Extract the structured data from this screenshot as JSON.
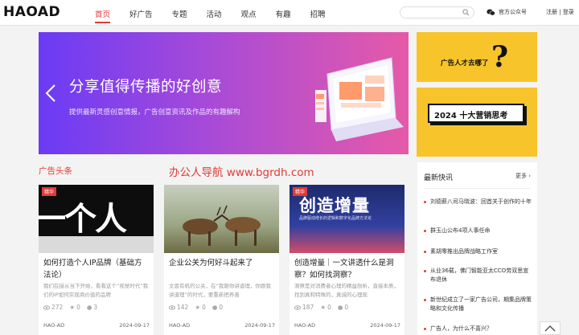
{
  "header": {
    "logo": "HAOAD",
    "nav": [
      "首页",
      "好广告",
      "专题",
      "活动",
      "观点",
      "有趣",
      "招聘"
    ],
    "search_placeholder": "",
    "wechat_label": "官方公众号",
    "login": "注册",
    "register": "登录"
  },
  "banner": {
    "title": "分享值得传播的好创意",
    "subtitle": "提供最新灵感创意情报，广告创意资讯及作品的有趣解构"
  },
  "promos": {
    "promo1_text": "广告人才去哪了",
    "promo2_text": "2024 十大营销思考"
  },
  "section": {
    "title": "广告头条",
    "watermark": "办公人导航 www.bgrdh.com"
  },
  "cards": [
    {
      "tag": "精华",
      "img_text": "一个人",
      "title": "如何打造个人IP品牌（基础方法论）",
      "desc": "我们在接从当下开始，看看这个“视觉时代”我们的IP如何实现商价值的品牌",
      "views": "272",
      "likes": "0",
      "comments": "3",
      "author": "HAO-AD",
      "date": "2024-09-17"
    },
    {
      "tag": "",
      "img_text": "",
      "title": "企业公关为何好斗起来了",
      "desc": "文恩有机的公关，在“我跟你讲道理，你跟我讲道理”的时代，要重新把养善",
      "views": "142",
      "likes": "0",
      "comments": "0",
      "author": "HAO-AD",
      "date": "2024-09-17"
    },
    {
      "tag": "精华",
      "img_text": "创造增量",
      "img_sub": "品牌驱动增长的逻辑和数字化品牌方法论",
      "title": "创造增量｜一文讲透什么是洞察？如何找洞察？",
      "desc": "洞察是对消费者心理的精益剖析，直接本质，找到真和特殊的，真诚的心理现",
      "views": "187",
      "likes": "0",
      "comments": "0",
      "author": "HAO-AD",
      "date": "2024-09-17"
    }
  ],
  "news": {
    "title": "最新快讯",
    "more": "更多",
    "items": [
      "刘德薪八司马晓波：回首关于创作的十年",
      "群玉山公布4项人事任命",
      "素胡零推出品牌战略工作室",
      "从业36载，佛门智能亚太CCO劳双思宣布退休",
      "新世纪成立了一家广告公司，期集品牌策略和文化传播",
      "广告人，为什么不喜兴？"
    ]
  },
  "colors": {
    "accent": "#e53935",
    "promo_yellow": "#f7c52b",
    "banner_start": "#6a3bf5",
    "banner_end": "#e65aa8"
  }
}
